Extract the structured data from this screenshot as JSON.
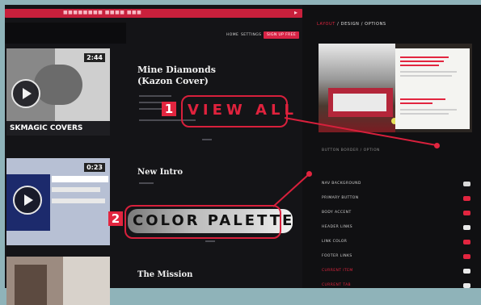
{
  "top_bar": {
    "url_text": "■■■■■■■■ ■■■■ ■■■"
  },
  "nav": {
    "items": [
      "HOME",
      "SETTINGS",
      "SIGN UP FREE"
    ]
  },
  "videos": [
    {
      "duration": "2:44",
      "label": "SKMAGIC COVERS"
    },
    {
      "duration": "0:23",
      "label": ""
    },
    {
      "duration": "",
      "label": ""
    }
  ],
  "posts": [
    {
      "title_line1": "Mine Diamonds",
      "title_line2": "(Kazon Cover)"
    },
    {
      "title_line1": "New Intro",
      "title_line2": ""
    },
    {
      "title_line1": "The Mission",
      "title_line2": ""
    }
  ],
  "callouts": [
    {
      "number": "1",
      "text": "VIEW ALL"
    },
    {
      "number": "2",
      "text": "COLOR PALETTE"
    }
  ],
  "right_panel": {
    "header_red": "LAYOUT",
    "header_rest": " / DESIGN / OPTIONS",
    "section_label": "BUTTON BORDER / OPTION",
    "rows": [
      {
        "label": "NAV BACKGROUND",
        "red": false,
        "color": "#d9d9d9"
      },
      {
        "label": "PRIMARY BUTTON",
        "red": false,
        "color": "#e2253f"
      },
      {
        "label": "BODY ACCENT",
        "red": false,
        "color": "#e2253f"
      },
      {
        "label": "HEADER LINKS",
        "red": false,
        "color": "#e9e9e9"
      },
      {
        "label": "LINK COLOR",
        "red": false,
        "color": "#e2253f"
      },
      {
        "label": "FOOTER LINKS",
        "red": false,
        "color": "#e2253f"
      },
      {
        "label": "CURRENT ITEM",
        "red": true,
        "color": "#e9e9e9"
      },
      {
        "label": "CURRENT TAB",
        "red": true,
        "color": "#e9e9e9"
      }
    ]
  },
  "colors": {
    "accent": "#e2253f",
    "background": "#141417",
    "frame": "#8fb3b9"
  }
}
